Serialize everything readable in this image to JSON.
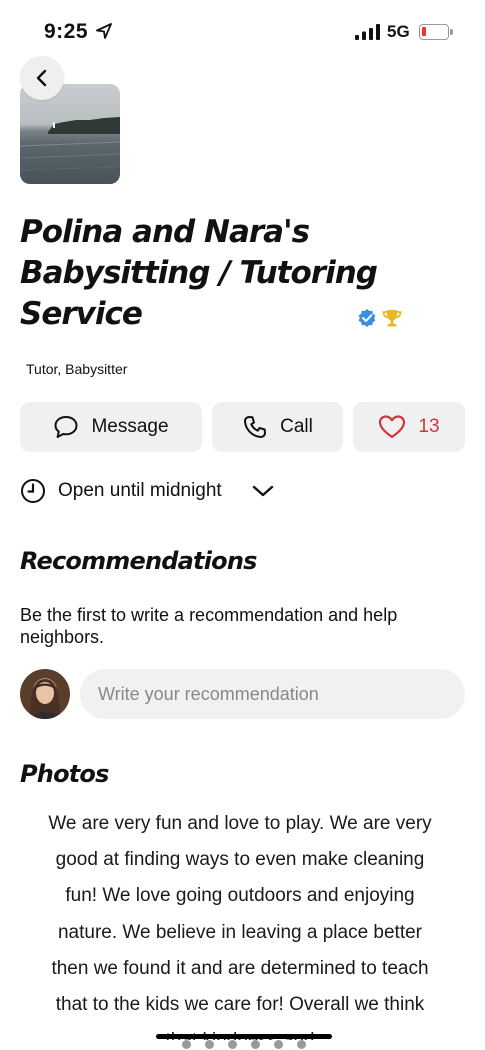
{
  "status_bar": {
    "time": "9:25",
    "network": "5G",
    "battery_level": 0.1,
    "icons": [
      "location-arrow-icon",
      "signal-icon",
      "battery-icon"
    ]
  },
  "business": {
    "name": "Polina and Nara's Babysitting / Tutoring Service",
    "categories": "Tutor, Babysitter",
    "badges": [
      "verified-icon",
      "trophy-icon"
    ]
  },
  "actions": {
    "message_label": "Message",
    "call_label": "Call",
    "like_count": "13"
  },
  "hours": {
    "status": "Open until midnight"
  },
  "recommendations": {
    "heading": "Recommendations",
    "prompt": "Be the first to write a recommendation and help neighbors.",
    "input_placeholder": "Write your recommendation"
  },
  "photos": {
    "heading": "Photos",
    "caption": "We are very fun and love to play. We are very good at finding ways to even make cleaning fun! We love going outdoors and enjoying nature. We believe in leaving a place better then we found it and are determined to teach that to the kids we care for! Overall we think that kindness and"
  },
  "colors": {
    "accent_like": "#d0353d",
    "verified": "#3b8de0",
    "trophy": "#e8b923",
    "button_bg": "#f0f0f0"
  }
}
